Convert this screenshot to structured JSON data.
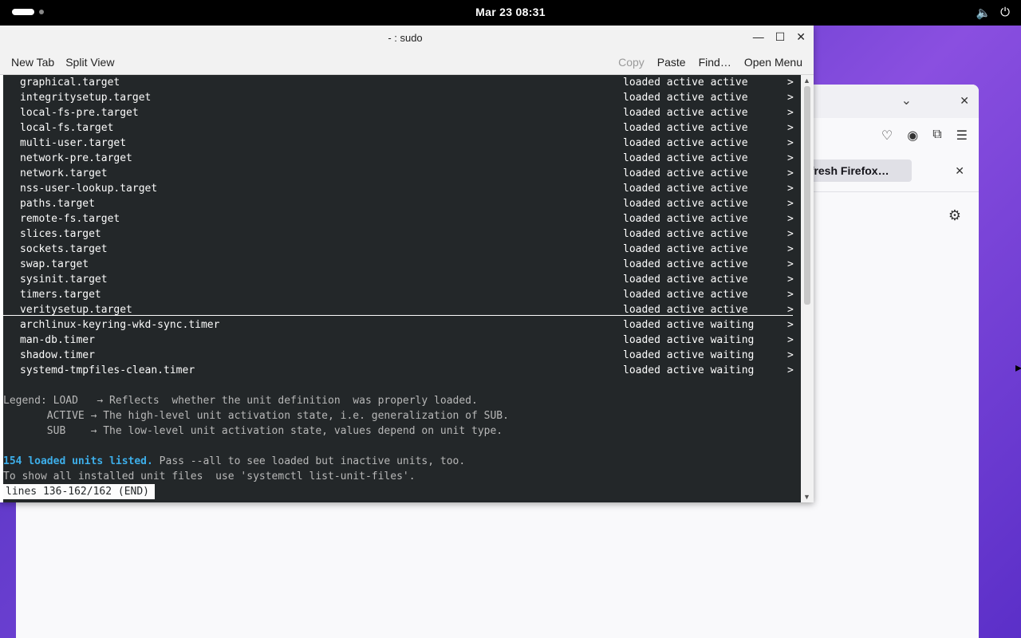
{
  "topbar": {
    "clock": "Mar 23  08:31",
    "icons": [
      "volume-icon",
      "power-icon"
    ]
  },
  "firefox": {
    "notification_label": "efresh Firefox…",
    "icons": [
      "chevron-down-icon",
      "close-icon",
      "pocket-icon",
      "account-icon",
      "extensions-icon",
      "menu-icon",
      "settings-icon"
    ]
  },
  "terminal": {
    "title": "- : sudo",
    "toolbar": {
      "new_tab": "New Tab",
      "split_view": "Split View",
      "copy": "Copy",
      "paste": "Paste",
      "find": "Find…",
      "open_menu": "Open Menu"
    },
    "units": [
      {
        "name": "graphical.target",
        "state": "loaded active active"
      },
      {
        "name": "integritysetup.target",
        "state": "loaded active active"
      },
      {
        "name": "local-fs-pre.target",
        "state": "loaded active active"
      },
      {
        "name": "local-fs.target",
        "state": "loaded active active"
      },
      {
        "name": "multi-user.target",
        "state": "loaded active active"
      },
      {
        "name": "network-pre.target",
        "state": "loaded active active"
      },
      {
        "name": "network.target",
        "state": "loaded active active"
      },
      {
        "name": "nss-user-lookup.target",
        "state": "loaded active active"
      },
      {
        "name": "paths.target",
        "state": "loaded active active"
      },
      {
        "name": "remote-fs.target",
        "state": "loaded active active"
      },
      {
        "name": "slices.target",
        "state": "loaded active active"
      },
      {
        "name": "sockets.target",
        "state": "loaded active active"
      },
      {
        "name": "swap.target",
        "state": "loaded active active"
      },
      {
        "name": "sysinit.target",
        "state": "loaded active active"
      },
      {
        "name": "timers.target",
        "state": "loaded active active"
      },
      {
        "name": "veritysetup.target",
        "state": "loaded active active"
      },
      {
        "name": "archlinux-keyring-wkd-sync.timer",
        "state": "loaded active waiting"
      },
      {
        "name": "man-db.timer",
        "state": "loaded active waiting"
      },
      {
        "name": "shadow.timer",
        "state": "loaded active waiting"
      },
      {
        "name": "systemd-tmpfiles-clean.timer",
        "state": "loaded active waiting"
      }
    ],
    "truncation_marker": ">",
    "legend": [
      "Legend: LOAD   → Reflects  whether the unit definition  was properly loaded.",
      "       ACTIVE → The high-level unit activation state, i.e. generalization of SUB.",
      "       SUB    → The low-level unit activation state, values depend on unit type."
    ],
    "summary_bold": "154 loaded units listed.",
    "summary_rest": " Pass --all to see loaded but inactive units, too.",
    "hint": "To show all installed unit files  use 'systemctl list-unit-files'.",
    "pager_status": "lines 136-162/162 (END)"
  },
  "colors": {
    "console_bg": "#232729",
    "console_fg": "#fcfcfc",
    "highlight_blue": "#3daee9"
  }
}
